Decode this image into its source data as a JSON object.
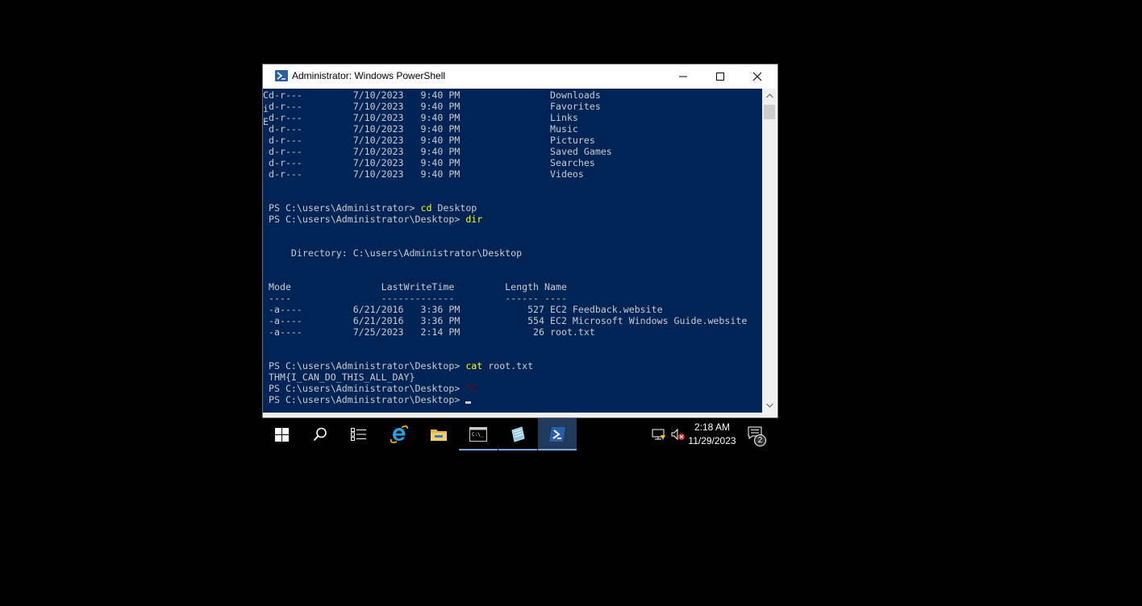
{
  "window": {
    "title": "Administrator: Windows PowerShell"
  },
  "console": {
    "left_clip": [
      "C",
      "i",
      "E"
    ],
    "lines": [
      [
        "d-r---",
        "7/10/2023",
        "9:40 PM",
        "",
        "Downloads"
      ],
      [
        "d-r---",
        "7/10/2023",
        "9:40 PM",
        "",
        "Favorites"
      ],
      [
        "d-r---",
        "7/10/2023",
        "9:40 PM",
        "",
        "Links"
      ],
      [
        "d-r---",
        "7/10/2023",
        "9:40 PM",
        "",
        "Music"
      ],
      [
        "d-r---",
        "7/10/2023",
        "9:40 PM",
        "",
        "Pictures"
      ],
      [
        "d-r---",
        "7/10/2023",
        "9:40 PM",
        "",
        "Saved Games"
      ],
      [
        "d-r---",
        "7/10/2023",
        "9:40 PM",
        "",
        "Searches"
      ],
      [
        "d-r---",
        "7/10/2023",
        "9:40 PM",
        "",
        "Videos"
      ]
    ],
    "prompt1": "PS C:\\users\\Administrator> ",
    "cmd1": "cd",
    "cmd1_arg": " Desktop",
    "prompt2": "PS C:\\users\\Administrator\\Desktop> ",
    "cmd2": "dir",
    "directory_line": "    Directory: C:\\users\\Administrator\\Desktop",
    "header": "Mode                LastWriteTime         Length Name",
    "header_sep": "----                -------------         ------ ----",
    "files": [
      [
        "-a----",
        "6/21/2016",
        "3:36 PM",
        "527",
        "EC2 Feedback.website"
      ],
      [
        "-a----",
        "6/21/2016",
        "3:36 PM",
        "554",
        "EC2 Microsoft Windows Guide.website"
      ],
      [
        "-a----",
        "7/25/2023",
        "2:14 PM",
        "26",
        "root.txt"
      ]
    ],
    "prompt3": "PS C:\\users\\Administrator\\Desktop> ",
    "cmd3": "cat",
    "cmd3_arg": " root.txt",
    "output3": "THM{I_CAN_DO_THIS_ALL_DAY}",
    "prompt4": "PS C:\\users\\Administrator\\Desktop> ",
    "cmd4": "^C",
    "prompt5": "PS C:\\users\\Administrator\\Desktop> "
  },
  "taskbar": {
    "time": "2:18 AM",
    "date": "11/29/2023",
    "notification_count": "2"
  },
  "colors": {
    "console_bg": "#012456",
    "console_fg": "#cccccc",
    "command": "#ffff00",
    "interrupt": "#8b0000"
  }
}
